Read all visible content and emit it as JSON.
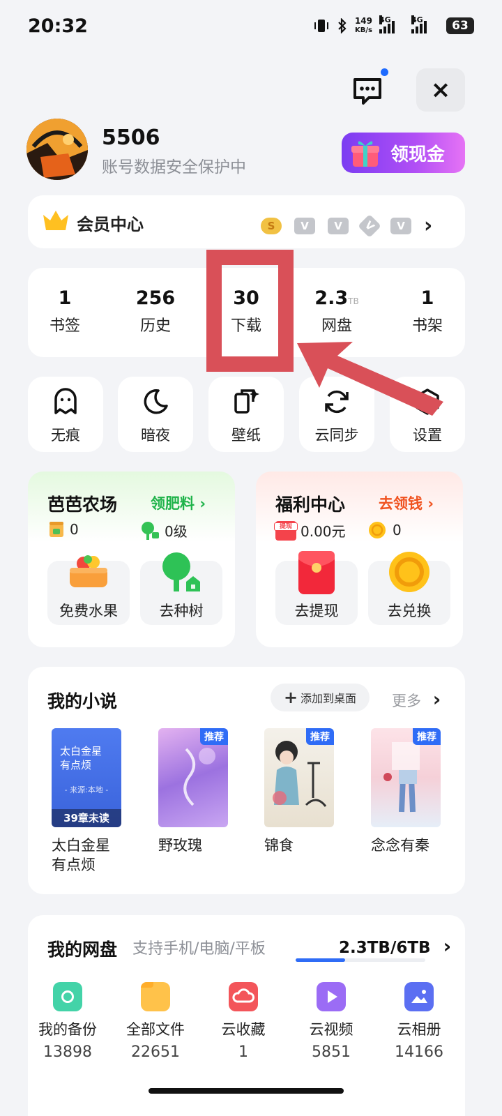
{
  "status_bar": {
    "time": "20:32",
    "speed_value": "149",
    "speed_unit": "KB/s",
    "net1": "4G",
    "net2": "4G",
    "battery": "63"
  },
  "header": {
    "message_icon": "message-icon",
    "close_label": "×"
  },
  "profile": {
    "username": "5506",
    "subtitle": "账号数据安全保护中",
    "cash_button": "领现金"
  },
  "vip": {
    "label": "会员中心",
    "badges": [
      "S",
      "V",
      "V",
      "V",
      "V"
    ]
  },
  "stats": [
    {
      "value": "1",
      "unit": "",
      "label": "书签"
    },
    {
      "value": "256",
      "unit": "",
      "label": "历史"
    },
    {
      "value": "30",
      "unit": "",
      "label": "下载"
    },
    {
      "value": "2.3",
      "unit": "TB",
      "label": "网盘"
    },
    {
      "value": "1",
      "unit": "",
      "label": "书架"
    }
  ],
  "tools": [
    {
      "label": "无痕",
      "icon": "ghost-icon"
    },
    {
      "label": "暗夜",
      "icon": "moon-icon"
    },
    {
      "label": "壁纸",
      "icon": "wallpaper-icon"
    },
    {
      "label": "云同步",
      "icon": "sync-icon"
    },
    {
      "label": "设置",
      "icon": "settings-icon"
    }
  ],
  "farm": {
    "title": "芭芭农场",
    "link": "领肥料",
    "stat1": "0",
    "stat2": "0级",
    "tile1": "免费水果",
    "tile2": "去种树",
    "color": "#1fb34a"
  },
  "welfare": {
    "title": "福利中心",
    "link": "去领钱",
    "stat1_tag": "提现",
    "stat1": "0.00元",
    "stat2": "0",
    "tile1": "去提现",
    "tile2": "去兑换",
    "color": "#f0521f"
  },
  "novels": {
    "title": "我的小说",
    "add_desktop": "添加到桌面",
    "more": "更多",
    "books": [
      {
        "title": "太白金星有点烦",
        "cover_line1": "太白金星",
        "cover_line2": "有点烦",
        "cover_source": "- 来源:本地 -",
        "cover_unread": "39章未读",
        "badge": ""
      },
      {
        "title": "野玫瑰",
        "badge": "推荐"
      },
      {
        "title": "锦食",
        "badge": "推荐"
      },
      {
        "title": "念念有秦",
        "badge": "推荐"
      }
    ]
  },
  "cloud": {
    "title": "我的网盘",
    "subtitle": "支持手机/电脑/平板",
    "usage": "2.3TB/6TB",
    "usage_fraction": 0.38,
    "items": [
      {
        "label": "我的备份",
        "count": "13898",
        "color": "#3ed1a6"
      },
      {
        "label": "全部文件",
        "count": "22651",
        "color": "#ffc24a"
      },
      {
        "label": "云收藏",
        "count": "1",
        "color": "#f3555a"
      },
      {
        "label": "云视频",
        "count": "5851",
        "color": "#9b6cf5"
      },
      {
        "label": "云相册",
        "count": "14166",
        "color": "#5b6ff2"
      }
    ]
  }
}
